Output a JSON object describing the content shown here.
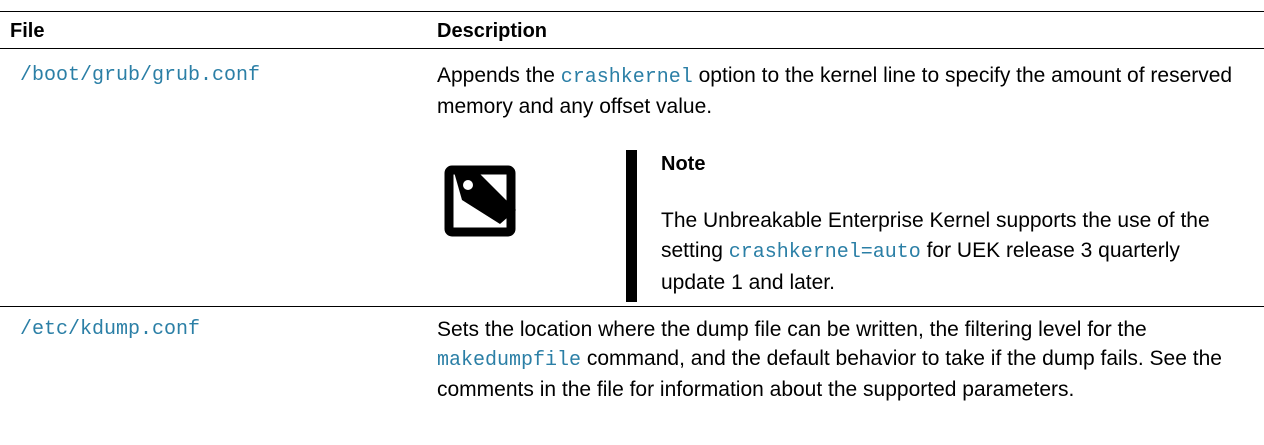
{
  "table": {
    "headers": {
      "file": "File",
      "description": "Description"
    },
    "rows": [
      {
        "file": "/boot/grub/grub.conf",
        "desc_pre": "Appends the ",
        "desc_code": "crashkernel",
        "desc_post": " option to the kernel line to specify the amount of reserved memory and any offset value.",
        "note": {
          "title": "Note",
          "body_pre": "The Unbreakable Enterprise Kernel supports the use of the setting ",
          "body_code": "crashkernel=auto",
          "body_post": " for UEK release 3 quarterly update 1 and later."
        }
      },
      {
        "file": "/etc/kdump.conf",
        "desc_pre": "Sets the location where the dump file can be written, the filtering level for the ",
        "desc_code": "makedumpfile",
        "desc_post": " command, and the default behavior to take if the dump fails. See the comments in the file for information about the supported parameters."
      }
    ]
  },
  "colors": {
    "code": "#2b7fa6",
    "text": "#000000"
  },
  "icons": {
    "note": "note-tag-icon"
  }
}
